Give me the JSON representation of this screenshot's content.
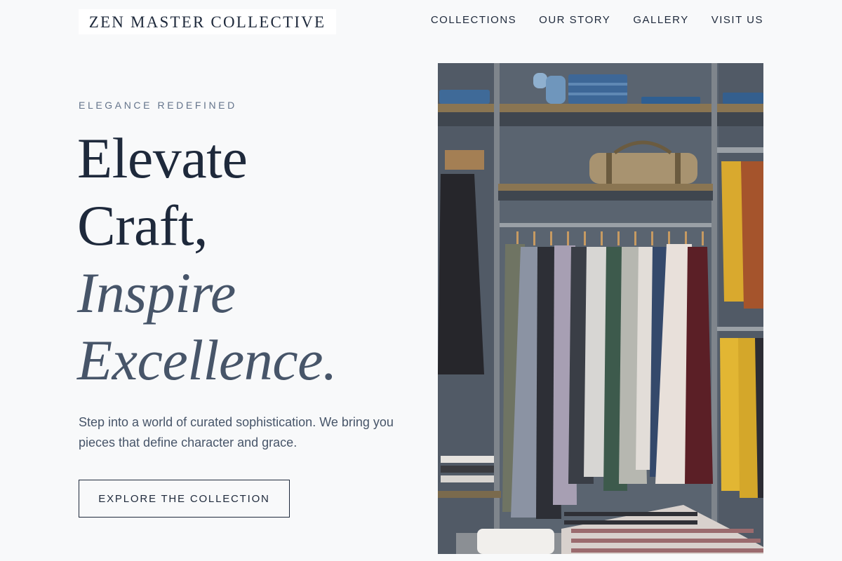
{
  "header": {
    "brand": "ZEN MASTER COLLECTIVE",
    "nav": [
      {
        "label": "COLLECTIONS"
      },
      {
        "label": "OUR STORY"
      },
      {
        "label": "GALLERY"
      },
      {
        "label": "VISIT US"
      }
    ]
  },
  "hero": {
    "eyebrow": "ELEGANCE REDEFINED",
    "headline": {
      "line1": "Elevate",
      "line2": "Craft,",
      "line3": "Inspire",
      "line4": "Excellence."
    },
    "description": "Step into a world of curated sophistication. We bring you pieces that define character and grace.",
    "cta_label": "EXPLORE THE COLLECTION",
    "image_label": "clothing-rack-photo"
  },
  "colors": {
    "background": "#f8f9fa",
    "text_primary": "#1e293b",
    "text_secondary": "#475569",
    "text_muted": "#64748b"
  }
}
